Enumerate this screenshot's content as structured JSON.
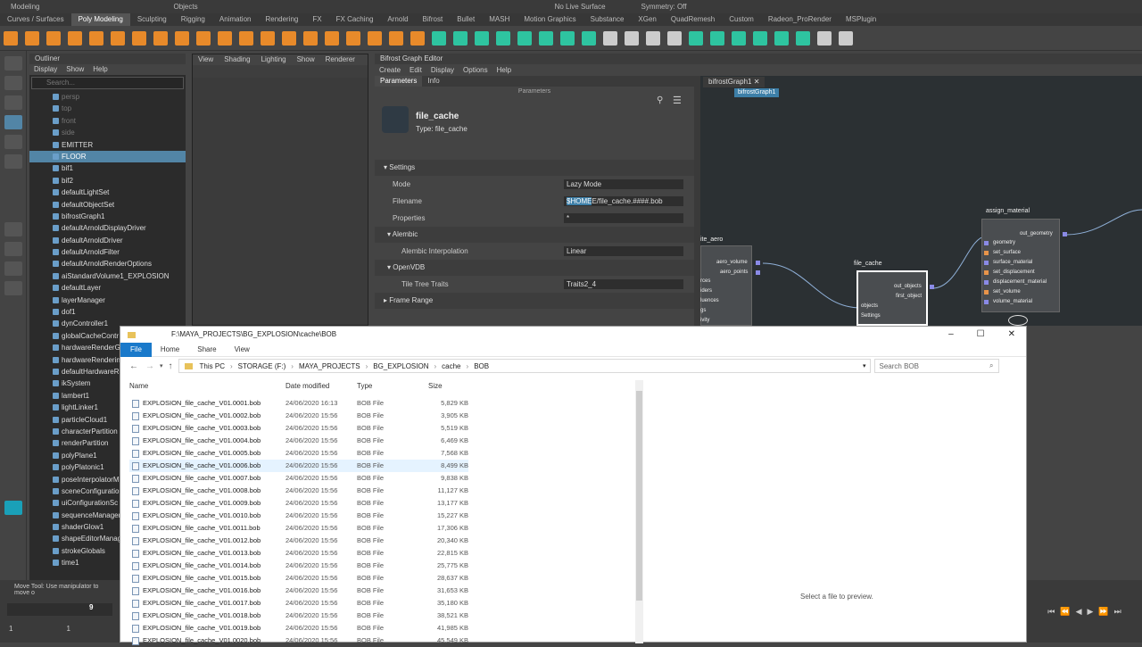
{
  "maya": {
    "topbar": {
      "workspace": "Modeling",
      "objects": "Objects",
      "live_surface": "No Live Surface",
      "symmetry": "Symmetry: Off"
    },
    "shelf_tabs": [
      "Curves / Surfaces",
      "Poly Modeling",
      "Sculpting",
      "Rigging",
      "Animation",
      "Rendering",
      "FX",
      "FX Caching",
      "Arnold",
      "Bifrost",
      "Bullet",
      "MASH",
      "Motion Graphics",
      "Substance",
      "XGen",
      "QuadRemesh",
      "Custom",
      "Radeon_ProRender",
      "MSPlugin"
    ],
    "active_shelf_tab": "Poly Modeling",
    "status_line": "Move Tool: Use manipulator to move o",
    "frame_start": "1",
    "frame_field": "1",
    "frame_tick": "9"
  },
  "outliner": {
    "title": "Outliner",
    "menu": [
      "Display",
      "Show",
      "Help"
    ],
    "search_placeholder": "Search...",
    "items": [
      {
        "label": "persp",
        "dim": true
      },
      {
        "label": "top",
        "dim": true
      },
      {
        "label": "front",
        "dim": true
      },
      {
        "label": "side",
        "dim": true
      },
      {
        "label": "EMITTER"
      },
      {
        "label": "FLOOR",
        "selected": true
      },
      {
        "label": "bif1"
      },
      {
        "label": "bif2"
      },
      {
        "label": "defaultLightSet"
      },
      {
        "label": "defaultObjectSet"
      },
      {
        "label": "bifrostGraph1"
      },
      {
        "label": "defaultArnoldDisplayDriver"
      },
      {
        "label": "defaultArnoldDriver"
      },
      {
        "label": "defaultArnoldFilter"
      },
      {
        "label": "defaultArnoldRenderOptions"
      },
      {
        "label": "aiStandardVolume1_EXPLOSION"
      },
      {
        "label": "defaultLayer"
      },
      {
        "label": "layerManager"
      },
      {
        "label": "dof1"
      },
      {
        "label": "dynController1"
      },
      {
        "label": "globalCacheContr"
      },
      {
        "label": "hardwareRenderG"
      },
      {
        "label": "hardwareRenderin"
      },
      {
        "label": "defaultHardwareR"
      },
      {
        "label": "ikSystem"
      },
      {
        "label": "lambert1"
      },
      {
        "label": "lightLinker1"
      },
      {
        "label": "particleCloud1"
      },
      {
        "label": "characterPartition"
      },
      {
        "label": "renderPartition"
      },
      {
        "label": "polyPlane1"
      },
      {
        "label": "polyPlatonic1"
      },
      {
        "label": "poseInterpolatorM"
      },
      {
        "label": "sceneConfiguratio"
      },
      {
        "label": "uiConfigurationSc"
      },
      {
        "label": "sequenceManager"
      },
      {
        "label": "shaderGlow1"
      },
      {
        "label": "shapeEditorManag"
      },
      {
        "label": "strokeGlobals"
      },
      {
        "label": "time1"
      }
    ]
  },
  "viewport": {
    "menu": [
      "View",
      "Shading",
      "Lighting",
      "Show",
      "Renderer"
    ]
  },
  "bifrost": {
    "title": "Bifrost Graph Editor",
    "menu": [
      "Create",
      "Edit",
      "Display",
      "Options",
      "Help"
    ],
    "tabs": [
      "Parameters",
      "Info"
    ],
    "panel_label": "Parameters",
    "node_name": "file_cache",
    "node_type": "Type: file_cache",
    "settings_header": "Settings",
    "params": [
      {
        "label": "Mode",
        "value": "Lazy Mode"
      },
      {
        "label": "Filename",
        "value_highlight": "$HOME",
        "value": "E/file_cache.####.bob"
      },
      {
        "label": "Properties",
        "value": "*"
      }
    ],
    "alembic_header": "Alembic",
    "alembic_param": {
      "label": "Alembic Interpolation",
      "value": "Linear"
    },
    "openvdb_header": "OpenVDB",
    "openvdb_param": {
      "label": "Tile Tree Traits",
      "value": "Traits2_4"
    },
    "frame_range_header": "Frame Range",
    "graph_tab": "bifrostGraph1",
    "graph_breadcrumb": "bifrostGraph1",
    "nodes": {
      "write_node": {
        "title": "ite_aero",
        "ports": [
          "aero_volume",
          "aero_points"
        ],
        "left_ports": [
          "rces",
          "iders",
          "luences",
          "gs",
          "ivity"
        ]
      },
      "file_cache": {
        "title": "file_cache",
        "out_ports": [
          "out_objects",
          "first_object"
        ],
        "in_ports": [
          "objects",
          "Settings"
        ]
      },
      "assign_material": {
        "title": "assign_material",
        "out": "out_geometry",
        "in_ports": [
          "geometry",
          "set_surface",
          "surface_material",
          "set_displacement",
          "displacement_material",
          "set_volume",
          "volume_material"
        ]
      }
    }
  },
  "explorer": {
    "title": "F:\\MAYA_PROJECTS\\BG_EXPLOSION\\cache\\BOB",
    "ribbon": [
      "File",
      "Home",
      "Share",
      "View"
    ],
    "breadcrumb": [
      "This PC",
      "STORAGE (F:)",
      "MAYA_PROJECTS",
      "BG_EXPLOSION",
      "cache",
      "BOB"
    ],
    "search_placeholder": "Search BOB",
    "columns": [
      "Name",
      "Date modified",
      "Type",
      "Size"
    ],
    "preview_text": "Select a file to preview.",
    "files": [
      {
        "name": "EXPLOSION_file_cache_V01.0001.bob",
        "date": "24/06/2020 16:13",
        "type": "BOB File",
        "size": "5,829 KB"
      },
      {
        "name": "EXPLOSION_file_cache_V01.0002.bob",
        "date": "24/06/2020 15:56",
        "type": "BOB File",
        "size": "3,905 KB"
      },
      {
        "name": "EXPLOSION_file_cache_V01.0003.bob",
        "date": "24/06/2020 15:56",
        "type": "BOB File",
        "size": "5,519 KB"
      },
      {
        "name": "EXPLOSION_file_cache_V01.0004.bob",
        "date": "24/06/2020 15:56",
        "type": "BOB File",
        "size": "6,469 KB"
      },
      {
        "name": "EXPLOSION_file_cache_V01.0005.bob",
        "date": "24/06/2020 15:56",
        "type": "BOB File",
        "size": "7,568 KB"
      },
      {
        "name": "EXPLOSION_file_cache_V01.0006.bob",
        "date": "24/06/2020 15:56",
        "type": "BOB File",
        "size": "8,499 KB",
        "hover": true
      },
      {
        "name": "EXPLOSION_file_cache_V01.0007.bob",
        "date": "24/06/2020 15:56",
        "type": "BOB File",
        "size": "9,838 KB"
      },
      {
        "name": "EXPLOSION_file_cache_V01.0008.bob",
        "date": "24/06/2020 15:56",
        "type": "BOB File",
        "size": "11,127 KB"
      },
      {
        "name": "EXPLOSION_file_cache_V01.0009.bob",
        "date": "24/06/2020 15:56",
        "type": "BOB File",
        "size": "13,177 KB"
      },
      {
        "name": "EXPLOSION_file_cache_V01.0010.bob",
        "date": "24/06/2020 15:56",
        "type": "BOB File",
        "size": "15,227 KB"
      },
      {
        "name": "EXPLOSION_file_cache_V01.0011.bob",
        "date": "24/06/2020 15:56",
        "type": "BOB File",
        "size": "17,306 KB"
      },
      {
        "name": "EXPLOSION_file_cache_V01.0012.bob",
        "date": "24/06/2020 15:56",
        "type": "BOB File",
        "size": "20,340 KB"
      },
      {
        "name": "EXPLOSION_file_cache_V01.0013.bob",
        "date": "24/06/2020 15:56",
        "type": "BOB File",
        "size": "22,815 KB"
      },
      {
        "name": "EXPLOSION_file_cache_V01.0014.bob",
        "date": "24/06/2020 15:56",
        "type": "BOB File",
        "size": "25,775 KB"
      },
      {
        "name": "EXPLOSION_file_cache_V01.0015.bob",
        "date": "24/06/2020 15:56",
        "type": "BOB File",
        "size": "28,637 KB"
      },
      {
        "name": "EXPLOSION_file_cache_V01.0016.bob",
        "date": "24/06/2020 15:56",
        "type": "BOB File",
        "size": "31,653 KB"
      },
      {
        "name": "EXPLOSION_file_cache_V01.0017.bob",
        "date": "24/06/2020 15:56",
        "type": "BOB File",
        "size": "35,180 KB"
      },
      {
        "name": "EXPLOSION_file_cache_V01.0018.bob",
        "date": "24/06/2020 15:56",
        "type": "BOB File",
        "size": "38,521 KB"
      },
      {
        "name": "EXPLOSION_file_cache_V01.0019.bob",
        "date": "24/06/2020 15:56",
        "type": "BOB File",
        "size": "41,985 KB"
      },
      {
        "name": "EXPLOSION_file_cache_V01.0020.bob",
        "date": "24/06/2020 15:56",
        "type": "BOB File",
        "size": "45,549 KB"
      }
    ]
  },
  "colors": {
    "accent": "#1979ca",
    "maya_select": "#5285a6",
    "port": "#8a8ae6"
  }
}
